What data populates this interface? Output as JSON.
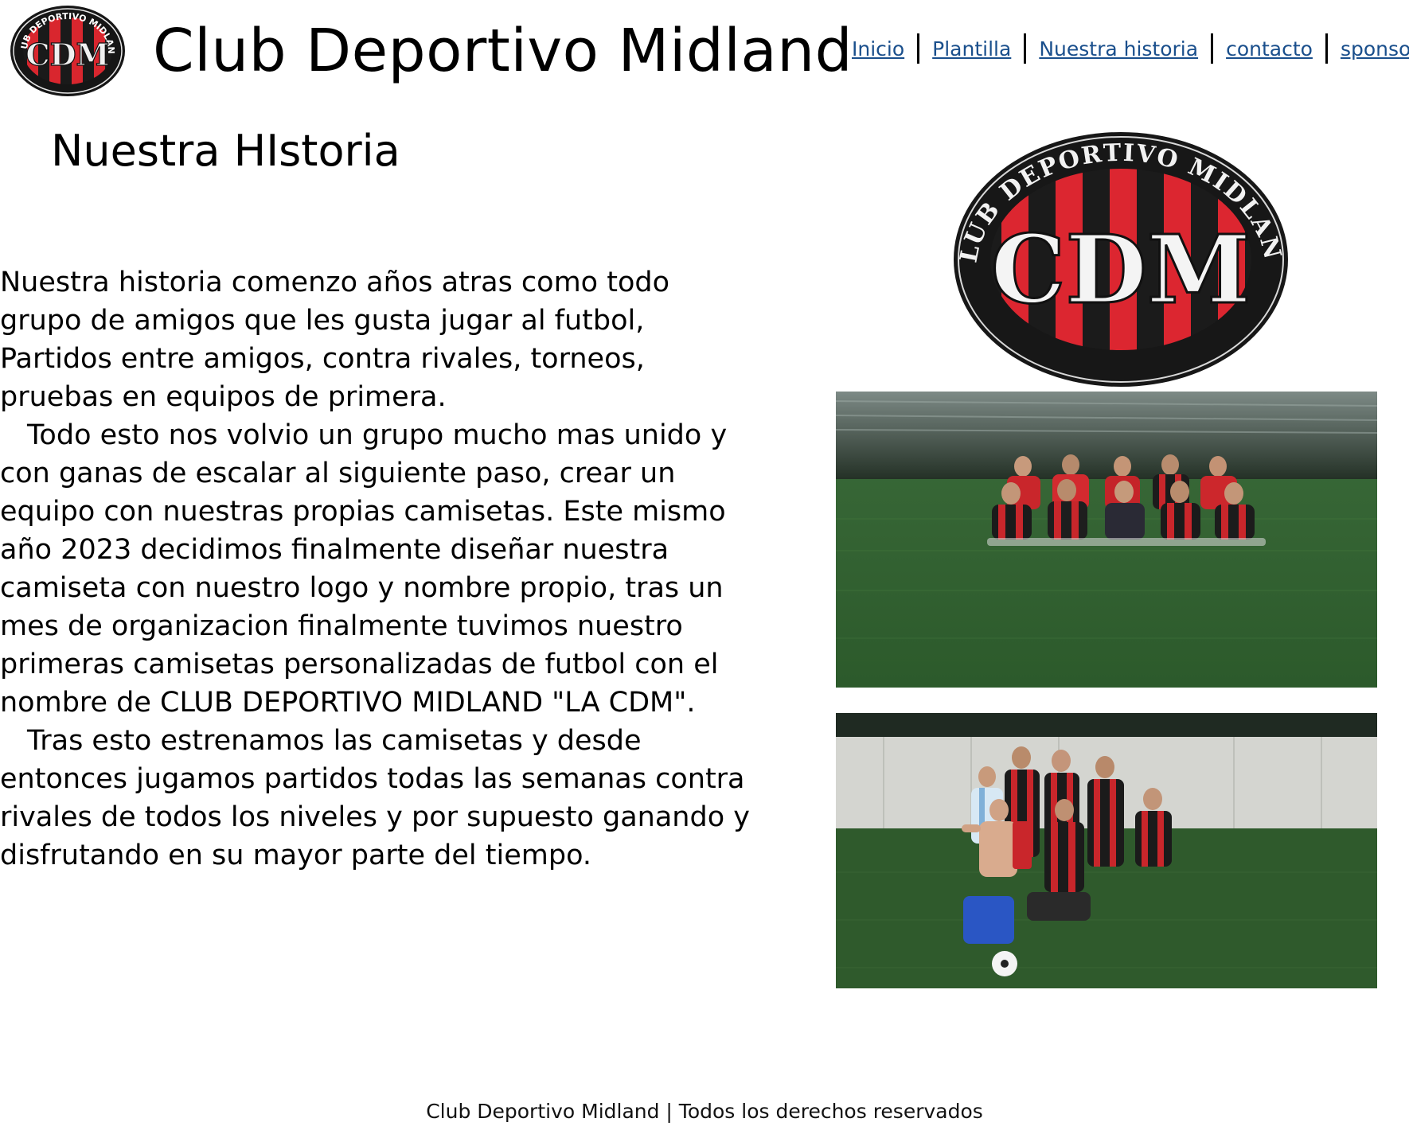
{
  "header": {
    "logo_text": "CDM",
    "logo_ring_text": "CLUB DEPORTIVO MIDLAND",
    "title": "Club Deportivo Midland"
  },
  "nav": {
    "items": [
      {
        "label": "Inicio"
      },
      {
        "label": "Plantilla"
      },
      {
        "label": "Nuestra historia"
      },
      {
        "label": "contacto"
      },
      {
        "label": "sponsors"
      }
    ]
  },
  "main": {
    "title": "Nuestra HIstoria",
    "paragraphs": [
      "Nuestra historia comenzo años atras como todo grupo de amigos que les gusta jugar al futbol, Partidos entre amigos, contra rivales, torneos, pruebas en equipos de primera.",
      "Todo esto nos volvio un grupo mucho mas unido y con ganas de escalar al siguiente paso, crear un equipo con nuestras propias camisetas. Este mismo año 2023 decidimos finalmente diseñar nuestra camiseta con nuestro logo y nombre propio, tras un mes de organizacion finalmente tuvimos nuestro primeras camisetas personalizadas de futbol con el nombre de CLUB DEPORTIVO MIDLAND \"LA CDM\".",
      "Tras esto estrenamos las camisetas y desde entonces jugamos partidos todas las semanas contra rivales de todos los niveles y por supuesto ganando y disfrutando en su mayor parte del tiempo."
    ]
  },
  "footer": {
    "text": "Club Deportivo Midland | Todos los derechos reservados"
  },
  "colors": {
    "link": "#1a4f8c",
    "logo_red": "#d9262e",
    "logo_dark": "#151515",
    "turf": "#2f5a2c"
  }
}
